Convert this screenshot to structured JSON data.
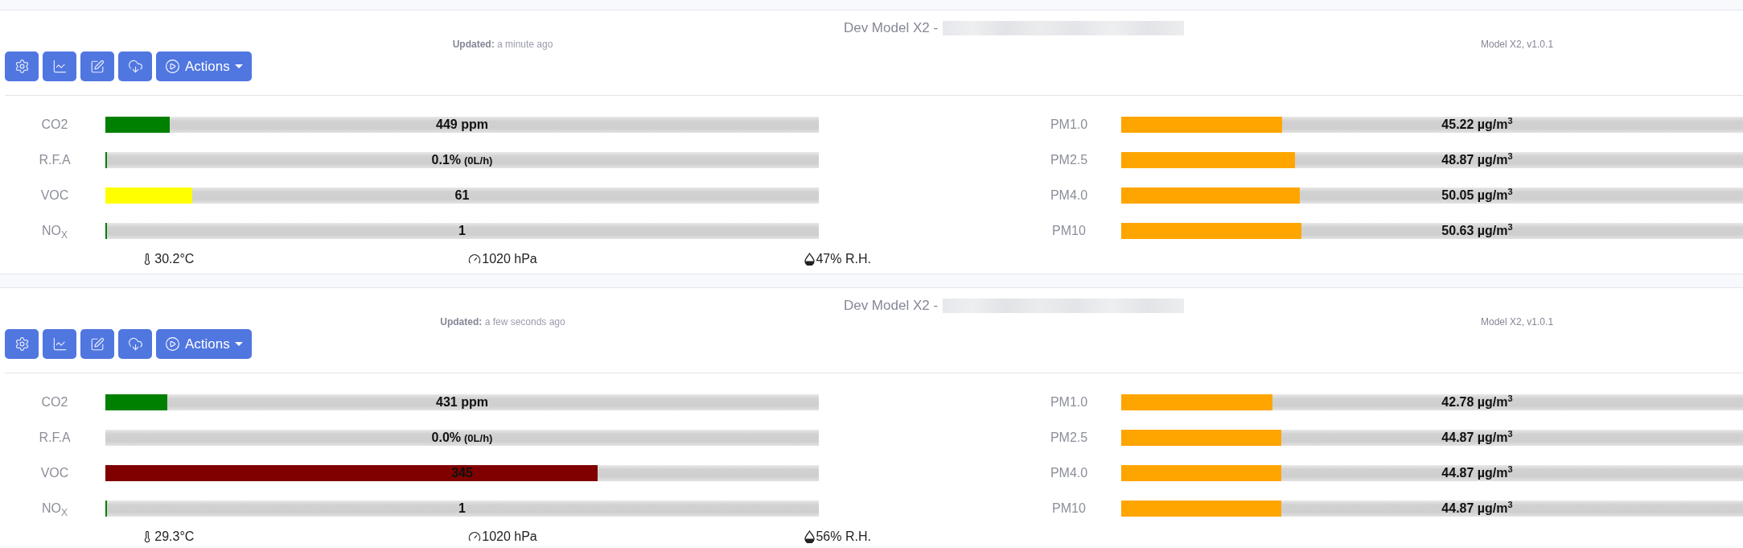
{
  "cards": [
    {
      "title": "Dev Model X2 -",
      "updated": "**Updated:** a minute ago",
      "model_version": "Model X2, v1.0.1",
      "actions_button": "Actions",
      "gases": [
        {
          "label": "CO2",
          "value": "449 ppm",
          "level": 0.09,
          "color": "#008000"
        },
        {
          "label": "R.F.A",
          "value": "0.1%",
          "detail": "(0L/h)",
          "level": 0.0025,
          "color": "#008000"
        },
        {
          "label": "VOC",
          "value": "61",
          "level": 0.122,
          "color": "#ffff00"
        },
        {
          "label": "NO$_{X}$",
          "value": "1",
          "level": 0.0025,
          "color": "#008000"
        }
      ],
      "particulates": [
        {
          "label": "PM1.0",
          "value": "45.22 µg/m$^{3}$",
          "level": 0.259,
          "color": "#ffa500"
        },
        {
          "label": "PM2.5",
          "value": "48.87 µg/m$^{3}$",
          "level": 0.279,
          "color": "#ffa500"
        },
        {
          "label": "PM4.0",
          "value": "50.05 µg/m$^{3}$",
          "level": 0.287,
          "color": "#ffa500"
        },
        {
          "label": "PM10",
          "value": "50.63 µg/m$^{3}$",
          "level": 0.29,
          "color": "#ffa500"
        }
      ],
      "temperature": "30.2°C",
      "pressure": "1020 hPa",
      "humidity": "47% R.H."
    },
    {
      "title": "Dev Model X2 -",
      "updated": "**Updated:** a few seconds ago",
      "model_version": "Model X2, v1.0.1",
      "actions_button": "Actions",
      "gases": [
        {
          "label": "CO2",
          "value": "431 ppm",
          "level": 0.087,
          "color": "#008000"
        },
        {
          "label": "R.F.A",
          "value": "0.0%",
          "detail": "(0L/h)"
        },
        {
          "label": "VOC",
          "value": "345",
          "level": 0.69,
          "color": "#800000"
        },
        {
          "label": "NO$_{X}$",
          "value": "1",
          "level": 0.0025,
          "color": "#008000"
        }
      ],
      "particulates": [
        {
          "label": "PM1.0",
          "value": "42.78 µg/m$^{3}$",
          "level": 0.243,
          "color": "#ffa500"
        },
        {
          "label": "PM2.5",
          "value": "44.87 µg/m$^{3}$",
          "level": 0.257,
          "color": "#ffa500"
        },
        {
          "label": "PM4.0",
          "value": "44.87 µg/m$^{3}$",
          "level": 0.257,
          "color": "#ffa500"
        },
        {
          "label": "PM10",
          "value": "44.87 µg/m$^{3}$",
          "level": 0.257,
          "color": "#ffa500"
        }
      ],
      "temperature": "29.3°C",
      "pressure": "1020 hPa",
      "humidity": "56% R.H."
    }
  ]
}
